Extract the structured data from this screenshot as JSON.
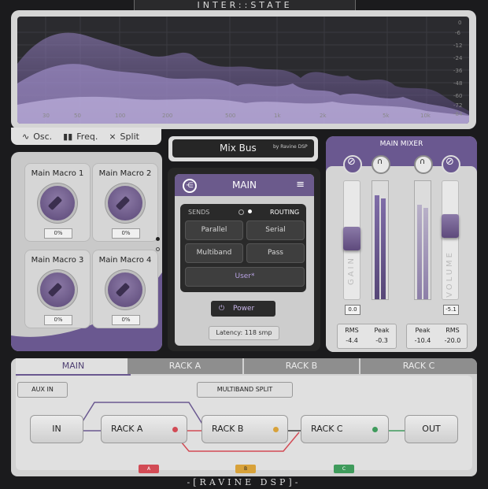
{
  "app": {
    "title": "INTER::STATE",
    "brand": "-[RAVINE DSP]-"
  },
  "spectrum": {
    "freq_labels": [
      "30",
      "50",
      "100",
      "200",
      "500",
      "1k",
      "2k",
      "5k",
      "10k"
    ],
    "db_labels": [
      "0",
      "-6",
      "-12",
      "-24",
      "-36",
      "-48",
      "-60",
      "-72",
      "-84"
    ],
    "tabs": [
      {
        "label": "Osc.",
        "icon": "wave-icon"
      },
      {
        "label": "Freq.",
        "icon": "bars-icon"
      },
      {
        "label": "Split",
        "icon": "split-icon"
      }
    ]
  },
  "mixbus": {
    "name": "Mix Bus",
    "by": "by Ravine DSP"
  },
  "macros": [
    {
      "label": "Main Macro 1",
      "value": "0%"
    },
    {
      "label": "Main Macro 2",
      "value": "0%"
    },
    {
      "label": "Main Macro 3",
      "value": "0%"
    },
    {
      "label": "Main Macro 4",
      "value": "0%"
    }
  ],
  "main": {
    "title": "MAIN",
    "sends_label": "SENDS",
    "routing_label": "ROUTING",
    "buttons": [
      "Parallel",
      "Serial",
      "Multiband",
      "Pass"
    ],
    "preset": "User*",
    "power": "Power",
    "latency": "Latency: 118 smp"
  },
  "mixer": {
    "title": "MAIN MIXER",
    "gain_label": "GAIN",
    "volume_label": "VOLUME",
    "gain_value": "0.0",
    "volume_value": "-5.1",
    "left_stats": {
      "rms_label": "RMS",
      "rms_value": "-4.4",
      "peak_label": "Peak",
      "peak_value": "-0.3"
    },
    "right_stats": {
      "peak_label": "Peak",
      "peak_value": "-10.4",
      "rms_label": "RMS",
      "rms_value": "-20.0"
    }
  },
  "rack": {
    "tabs": [
      "MAIN",
      "RACK A",
      "RACK B",
      "RACK C"
    ],
    "aux_in": "AUX IN",
    "split": "MULTIBAND SPLIT",
    "nodes": [
      "IN",
      "RACK A",
      "RACK B",
      "RACK C",
      "OUT"
    ],
    "tags": [
      "A",
      "B",
      "C"
    ]
  },
  "colors": {
    "accent": "#6a5890",
    "rack_a": "#d24b55",
    "rack_b": "#d8a23a",
    "rack_c": "#3f9b5c"
  }
}
